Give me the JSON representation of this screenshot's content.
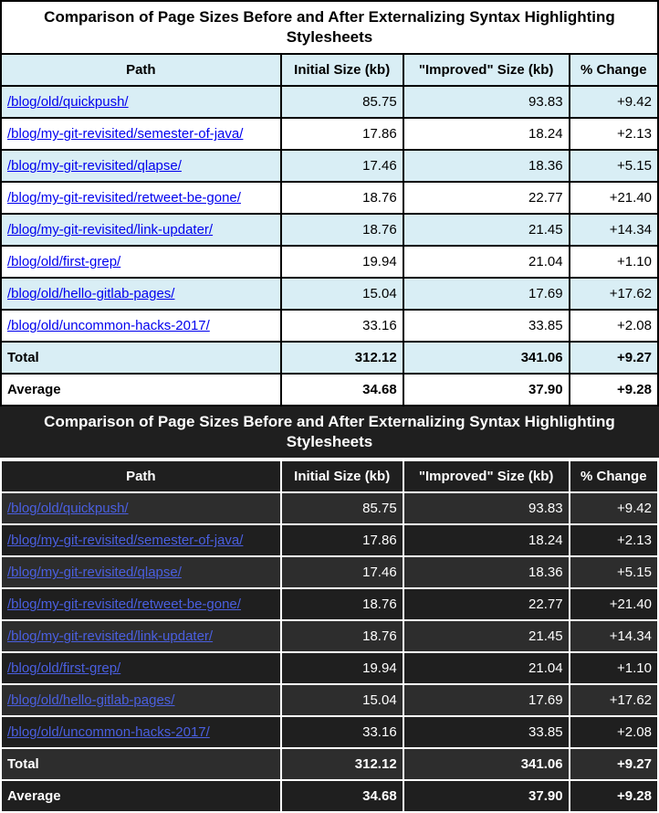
{
  "table": {
    "caption": "Comparison of Page Sizes Before and After Externalizing Syntax Highlighting Stylesheets",
    "columns": [
      "Path",
      "Initial Size (kb)",
      "\"Improved\" Size (kb)",
      "% Change"
    ],
    "rows": [
      {
        "path": "/blog/old/quickpush/",
        "initial": "85.75",
        "improved": "93.83",
        "change": "+9.42"
      },
      {
        "path": "/blog/my-git-revisited/semester-of-java/",
        "initial": "17.86",
        "improved": "18.24",
        "change": "+2.13"
      },
      {
        "path": "/blog/my-git-revisited/qlapse/",
        "initial": "17.46",
        "improved": "18.36",
        "change": "+5.15"
      },
      {
        "path": "/blog/my-git-revisited/retweet-be-gone/",
        "initial": "18.76",
        "improved": "22.77",
        "change": "+21.40"
      },
      {
        "path": "/blog/my-git-revisited/link-updater/",
        "initial": "18.76",
        "improved": "21.45",
        "change": "+14.34"
      },
      {
        "path": "/blog/old/first-grep/",
        "initial": "19.94",
        "improved": "21.04",
        "change": "+1.10"
      },
      {
        "path": "/blog/old/hello-gitlab-pages/",
        "initial": "15.04",
        "improved": "17.69",
        "change": "+17.62"
      },
      {
        "path": "/blog/old/uncommon-hacks-2017/",
        "initial": "33.16",
        "improved": "33.85",
        "change": "+2.08"
      }
    ],
    "summary": [
      {
        "label": "Total",
        "initial": "312.12",
        "improved": "341.06",
        "change": "+9.27"
      },
      {
        "label": "Average",
        "initial": "34.68",
        "improved": "37.90",
        "change": "+9.28"
      }
    ]
  },
  "chart_data": [
    {
      "type": "table",
      "title": "Comparison of Page Sizes Before and After Externalizing Syntax Highlighting Stylesheets",
      "columns": [
        "Path",
        "Initial Size (kb)",
        "\"Improved\" Size (kb)",
        "% Change"
      ],
      "rows": [
        [
          "/blog/old/quickpush/",
          85.75,
          93.83,
          9.42
        ],
        [
          "/blog/my-git-revisited/semester-of-java/",
          17.86,
          18.24,
          2.13
        ],
        [
          "/blog/my-git-revisited/qlapse/",
          17.46,
          18.36,
          5.15
        ],
        [
          "/blog/my-git-revisited/retweet-be-gone/",
          18.76,
          22.77,
          21.4
        ],
        [
          "/blog/my-git-revisited/link-updater/",
          18.76,
          21.45,
          14.34
        ],
        [
          "/blog/old/first-grep/",
          19.94,
          21.04,
          1.1
        ],
        [
          "/blog/old/hello-gitlab-pages/",
          15.04,
          17.69,
          17.62
        ],
        [
          "/blog/old/uncommon-hacks-2017/",
          33.16,
          33.85,
          2.08
        ]
      ],
      "summary": {
        "Total": [
          312.12,
          341.06,
          9.27
        ],
        "Average": [
          34.68,
          37.9,
          9.28
        ]
      }
    }
  ]
}
